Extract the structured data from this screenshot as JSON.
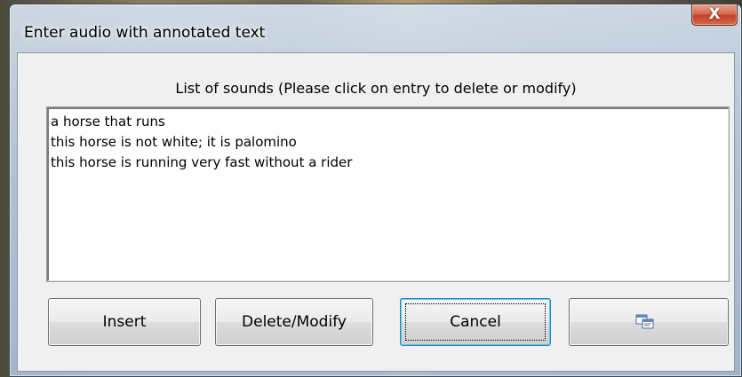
{
  "window": {
    "title": "Enter audio with annotated text",
    "close_label": "X"
  },
  "list": {
    "caption": "List of sounds (Please click on entry to delete or modify)",
    "items": [
      "a horse that runs",
      "this horse is not white; it is palomino",
      "this horse is running very fast without a rider"
    ]
  },
  "buttons": {
    "insert": "Insert",
    "delete_modify": "Delete/Modify",
    "cancel": "Cancel",
    "icon_button_icon": "copy-windows-icon"
  },
  "colors": {
    "close_button": "#c2412a",
    "focus_border": "#3c7fb1"
  }
}
